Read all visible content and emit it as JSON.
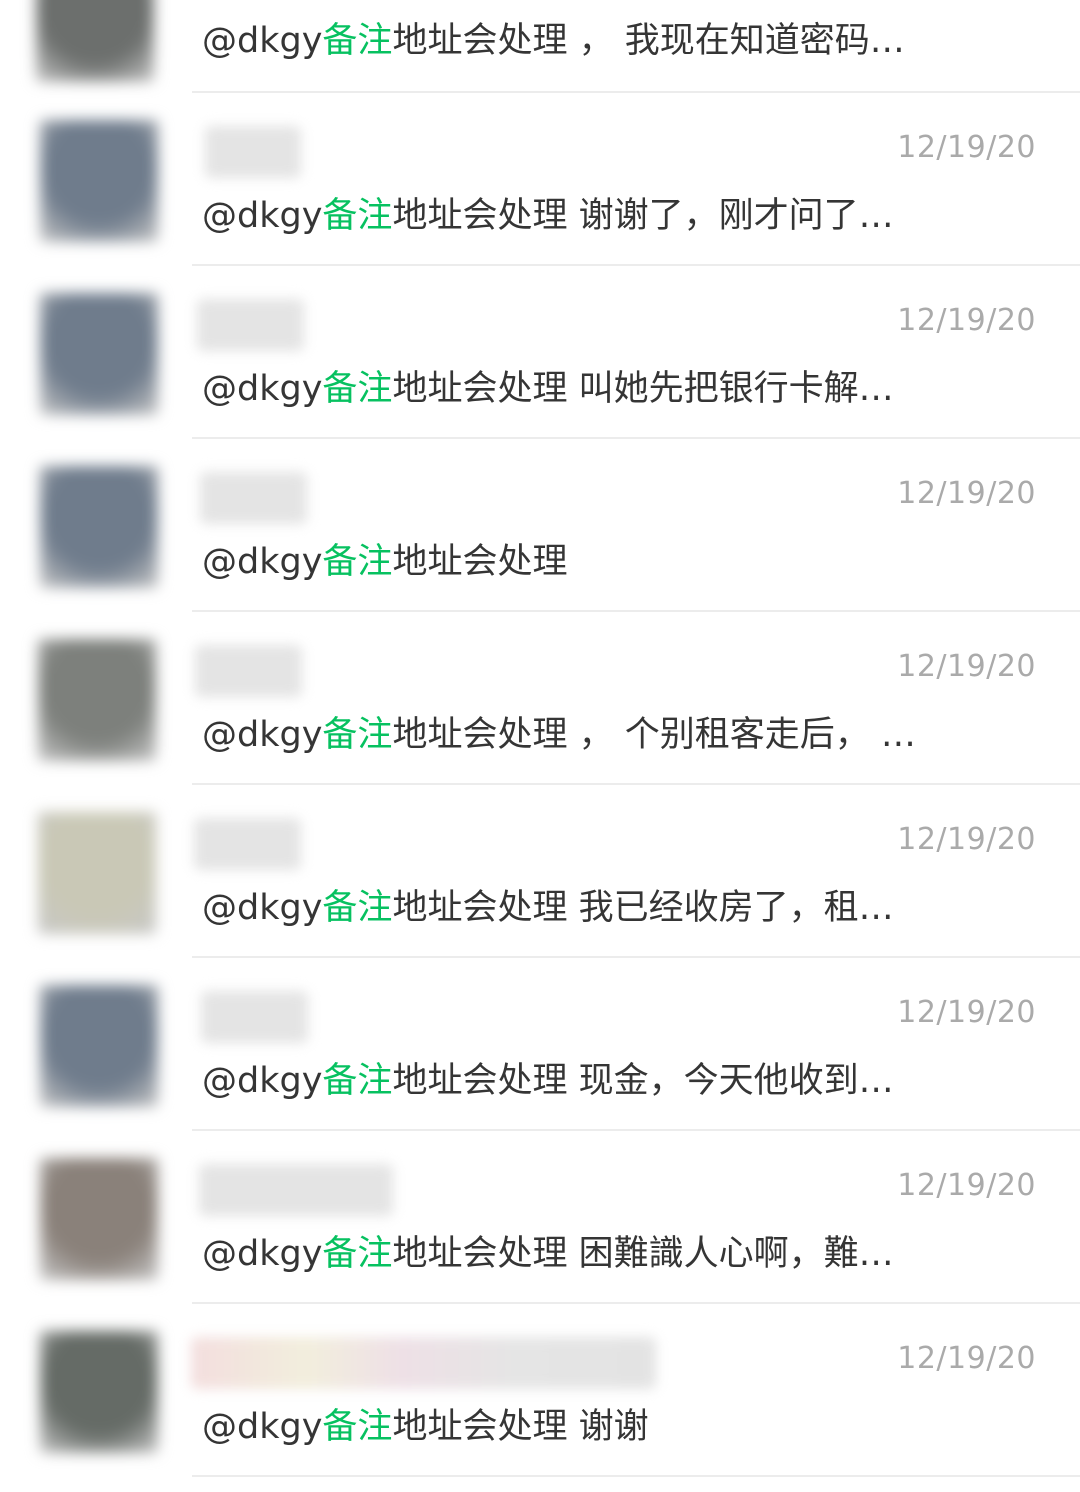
{
  "conversations": [
    {
      "message_prefix": "@dkgy",
      "message_highlight": "备注",
      "message_mid": "地址会处理",
      "message_suffix": " ， 我现在知道密码…",
      "time": "",
      "avatar_color": "#6c6f6d"
    },
    {
      "message_prefix": "@dkgy",
      "message_highlight": "备注",
      "message_mid": "地址会处理",
      "message_suffix": " 谢谢了，刚才问了…",
      "time": "12/19/20",
      "avatar_color": "#6f7c8c"
    },
    {
      "message_prefix": "@dkgy",
      "message_highlight": "备注",
      "message_mid": "地址会处理",
      "message_suffix": " 叫她先把银行卡解…",
      "time": "12/19/20",
      "avatar_color": "#6f7c8c"
    },
    {
      "message_prefix": "@dkgy",
      "message_highlight": "备注",
      "message_mid": "地址会处理",
      "message_suffix": "",
      "time": "12/19/20",
      "avatar_color": "#6f7c8c"
    },
    {
      "message_prefix": "@dkgy",
      "message_highlight": "备注",
      "message_mid": "地址会处理",
      "message_suffix": " ， 个别租客走后， …",
      "time": "12/19/20",
      "avatar_color": "#7d807c"
    },
    {
      "message_prefix": "@dkgy",
      "message_highlight": "备注",
      "message_mid": "地址会处理",
      "message_suffix": " 我已经收房了，租…",
      "time": "12/19/20",
      "avatar_color": "#c9c8b6"
    },
    {
      "message_prefix": "@dkgy",
      "message_highlight": "备注",
      "message_mid": "地址会处理",
      "message_suffix": " 现金，今天他收到…",
      "time": "12/19/20",
      "avatar_color": "#6f7c8c"
    },
    {
      "message_prefix": "@dkgy",
      "message_highlight": "备注",
      "message_mid": "地址会处理",
      "message_suffix": " 困難識人心啊，難…",
      "time": "12/19/20",
      "avatar_color": "#8a817a"
    },
    {
      "message_prefix": "@dkgy",
      "message_highlight": "备注",
      "message_mid": "地址会处理",
      "message_suffix": " 谢谢",
      "time": "12/19/20",
      "avatar_color": "#656b66"
    }
  ]
}
